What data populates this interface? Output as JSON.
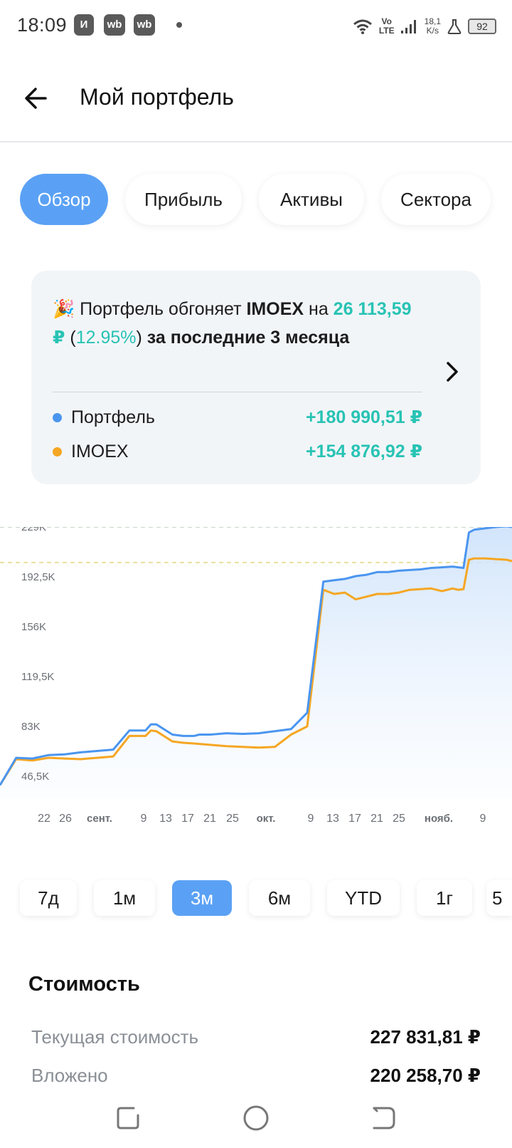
{
  "status_bar": {
    "time": "18:09",
    "apps": [
      "И",
      "wb",
      "wb"
    ],
    "network_top": "Vo",
    "network_bottom": "LTE",
    "speed_top": "18,1",
    "speed_bottom": "K/s",
    "battery": "92"
  },
  "header": {
    "title": "Мой портфель",
    "back_icon": "arrow-left-icon"
  },
  "tabs": [
    {
      "label": "Обзор",
      "active": true
    },
    {
      "label": "Прибыль",
      "active": false
    },
    {
      "label": "Активы",
      "active": false
    },
    {
      "label": "Сектора",
      "active": false
    }
  ],
  "card": {
    "emoji": "🎉",
    "msg_1": "Портфель обгоняет ",
    "msg_index": "IMOEX",
    "msg_2": " на",
    "msg_amount": "26 113,59 ₽",
    "msg_pct_open": " (",
    "msg_pct": "12.95%",
    "msg_pct_close": ")",
    "msg_3": " за последние 3 месяца",
    "legend": [
      {
        "name": "Портфель",
        "value": "+180 990,51 ₽",
        "color": "#4a95ef"
      },
      {
        "name": "IMOEX",
        "value": "+154 876,92 ₽",
        "color": "#f5a623"
      }
    ]
  },
  "chart_data": {
    "type": "line",
    "y_ticks": [
      "229K",
      "192,5K",
      "156K",
      "119,5K",
      "83K",
      "46,5K"
    ],
    "x_ticks": [
      "22",
      "26",
      "сент.",
      "9",
      "13",
      "17",
      "21",
      "25",
      "окт.",
      "9",
      "13",
      "17",
      "21",
      "25",
      "нояб.",
      "9"
    ],
    "ylim": [
      46500,
      229000
    ],
    "series": [
      {
        "name": "Портфель",
        "color": "#4a95ef",
        "x": [
          0,
          3,
          6,
          9,
          12,
          15,
          18,
          21,
          24,
          27,
          28,
          29,
          32,
          34,
          36,
          37,
          39,
          42,
          45,
          48,
          51,
          54,
          57,
          60,
          62,
          64,
          66,
          68,
          69,
          70,
          72,
          74,
          76,
          78,
          80,
          82,
          84,
          86,
          87,
          88,
          90,
          92,
          94,
          95
        ],
        "values": [
          40000,
          60000,
          59500,
          62000,
          62500,
          64000,
          65000,
          66000,
          80000,
          80000,
          84500,
          84500,
          77000,
          76000,
          76000,
          77000,
          77000,
          78000,
          77500,
          78000,
          79500,
          81000,
          93000,
          189000,
          190000,
          191000,
          193000,
          194000,
          195000,
          196000,
          196000,
          197000,
          197500,
          198000,
          199000,
          199500,
          200000,
          199000,
          225000,
          227000,
          228000,
          229000,
          229500,
          229000
        ]
      },
      {
        "name": "IMOEX",
        "color": "#f5a623",
        "x": [
          0,
          3,
          6,
          9,
          12,
          15,
          18,
          21,
          24,
          27,
          28,
          29,
          32,
          34,
          36,
          39,
          42,
          45,
          48,
          51,
          54,
          57,
          60,
          62,
          64,
          66,
          67,
          68,
          70,
          72,
          74,
          76,
          78,
          80,
          82,
          84,
          85,
          86,
          87,
          88,
          90,
          92,
          94,
          95
        ],
        "values": [
          40000,
          59000,
          58000,
          60000,
          59500,
          59000,
          60000,
          61000,
          76000,
          76000,
          80000,
          79500,
          72000,
          71000,
          70500,
          69500,
          68500,
          68000,
          67500,
          68000,
          77000,
          83000,
          183000,
          180000,
          181000,
          176000,
          177000,
          178000,
          180000,
          180000,
          181000,
          183000,
          183500,
          184000,
          182000,
          184000,
          183000,
          183500,
          205000,
          206000,
          206000,
          205500,
          205000,
          204000
        ]
      }
    ],
    "reference_lines": [
      229000,
      203000
    ],
    "grid": false
  },
  "periods": [
    {
      "label": "7д",
      "active": false
    },
    {
      "label": "1м",
      "active": false
    },
    {
      "label": "3м",
      "active": true
    },
    {
      "label": "6м",
      "active": false
    },
    {
      "label": "YTD",
      "active": false
    },
    {
      "label": "1г",
      "active": false
    },
    {
      "label": "5",
      "active": false
    }
  ],
  "value_section": {
    "title": "Стоимость",
    "rows": [
      {
        "label": "Текущая стоимость",
        "value": "227 831,81 ₽"
      },
      {
        "label": "Вложено",
        "value": "220 258,70 ₽"
      }
    ]
  },
  "nav": {
    "recents_icon": "recents-icon",
    "home_icon": "home-circle-icon",
    "back_icon": "back-gesture-icon"
  }
}
